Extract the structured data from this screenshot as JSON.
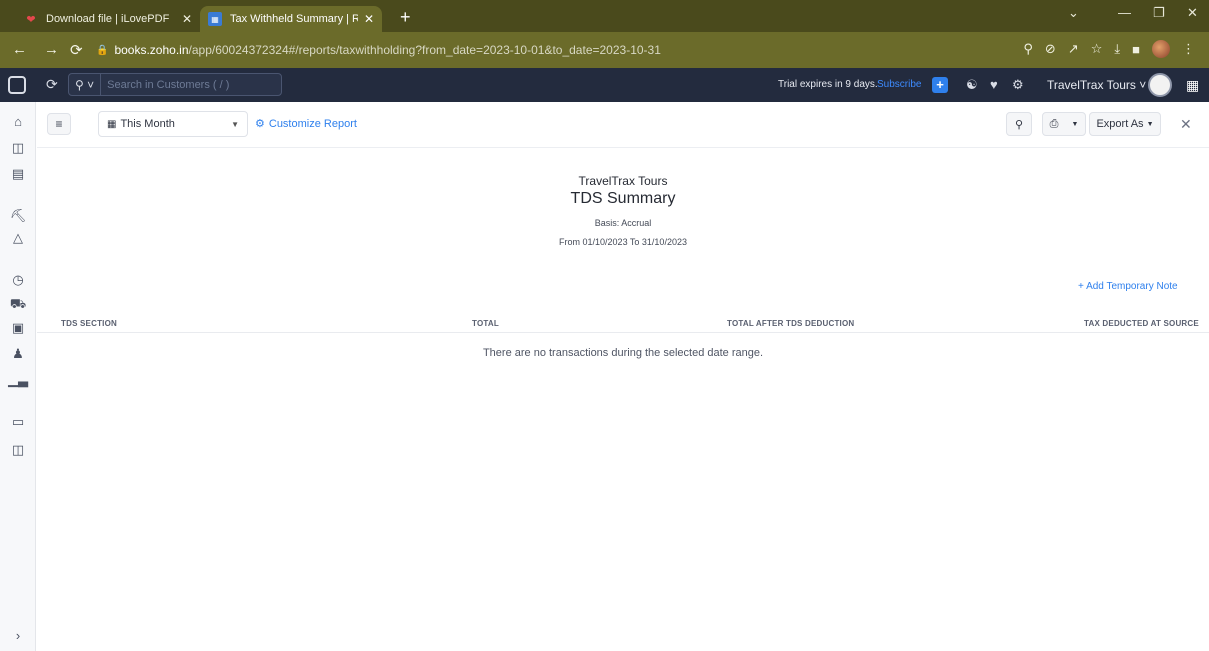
{
  "browser": {
    "tabs": [
      {
        "title": "Download file | iLovePDF",
        "icon": "heart-icon"
      },
      {
        "title": "Tax Withheld Summary | Reports",
        "icon": "zoho-books-icon"
      }
    ],
    "url_host": "books.zoho.in",
    "url_path": "/app/60024372324#/reports/taxwithholding?from_date=2023-10-01&to_date=2023-10-31"
  },
  "app_bar": {
    "search_placeholder": "Search in Customers ( / )",
    "trial_text": "Trial expires in 9 days.",
    "subscribe_label": "Subscribe",
    "org_name": "TravelTrax Tours"
  },
  "toolbar": {
    "period_label": "This Month",
    "customize_label": "Customize Report",
    "export_label": "Export As"
  },
  "report": {
    "org_name": "TravelTrax Tours",
    "title": "TDS Summary",
    "basis": "Basis: Accrual",
    "date_range": "From 01/10/2023 To 31/10/2023",
    "add_note_label": "+ Add Temporary Note",
    "columns": [
      "TDS SECTION",
      "TOTAL",
      "TOTAL AFTER TDS DEDUCTION",
      "TAX DEDUCTED AT SOURCE"
    ],
    "empty_message": "There are no transactions during the selected date range."
  },
  "colors": {
    "accent": "#2f80ed",
    "app_bar": "#232b3e",
    "browser_frame": "#6b6b2a"
  }
}
